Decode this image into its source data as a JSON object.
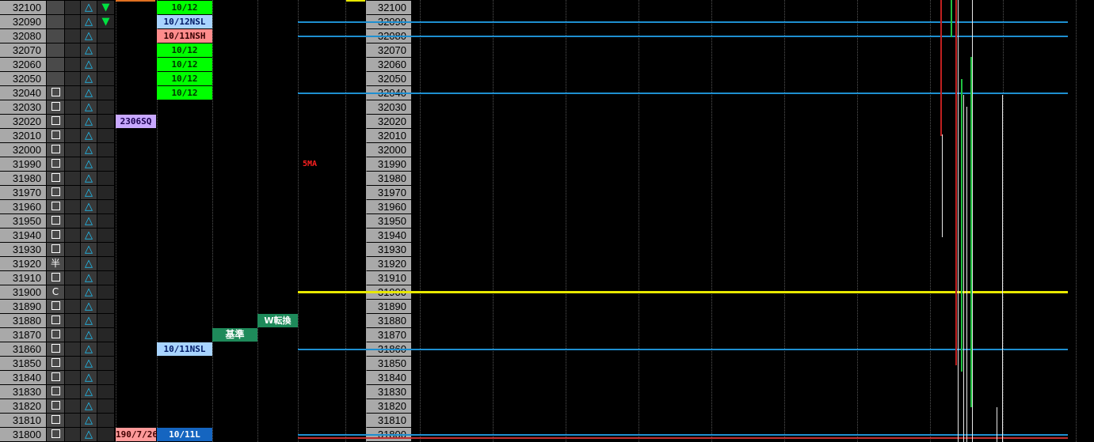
{
  "prices": [
    "32100",
    "32090",
    "32080",
    "32070",
    "32060",
    "32050",
    "32040",
    "32030",
    "32020",
    "32010",
    "32000",
    "31990",
    "31980",
    "31970",
    "31960",
    "31950",
    "31940",
    "31930",
    "31920",
    "31910",
    "31900",
    "31890",
    "31880",
    "31870",
    "31860",
    "31850",
    "31840",
    "31830",
    "31820",
    "31810",
    "31800"
  ],
  "marks": [
    "",
    "",
    "",
    "",
    "",
    "",
    "box",
    "box",
    "box",
    "box",
    "box",
    "box",
    "box",
    "box",
    "box",
    "box",
    "box",
    "box",
    "半",
    "box",
    "C",
    "box",
    "box",
    "box",
    "box",
    "box",
    "box",
    "box",
    "box",
    "box",
    "box"
  ],
  "triangle_glyph": "△",
  "arrow_glyph": "▼",
  "arrow_rows": [
    0,
    1
  ],
  "tags": [
    {
      "row": 0,
      "col": "c2",
      "text": "10/12",
      "style": "t-green"
    },
    {
      "row": 1,
      "col": "c2",
      "text": "10/12NSL",
      "style": "t-blue"
    },
    {
      "row": 2,
      "col": "c2",
      "text": "10/11NSH",
      "style": "t-red"
    },
    {
      "row": 3,
      "col": "c2",
      "text": "10/12",
      "style": "t-green"
    },
    {
      "row": 4,
      "col": "c2",
      "text": "10/12",
      "style": "t-green"
    },
    {
      "row": 5,
      "col": "c2",
      "text": "10/12",
      "style": "t-green"
    },
    {
      "row": 6,
      "col": "c2",
      "text": "10/12",
      "style": "t-green"
    },
    {
      "row": 8,
      "col": "c1",
      "text": "2306SQ",
      "style": "t-purple"
    },
    {
      "row": 24,
      "col": "c2",
      "text": "10/11NSL",
      "style": "t-blue"
    },
    {
      "row": 30,
      "col": "c1",
      "text": "190/7/26",
      "style": "t-pink"
    },
    {
      "row": 30,
      "col": "c2",
      "text": "10/11L",
      "style": "t-dblue"
    },
    {
      "row": 23,
      "col": "c3",
      "text": "基準",
      "style": "t-kijun"
    },
    {
      "row": 22,
      "col": "c4",
      "text": "W転換",
      "style": "t-tenkan"
    }
  ],
  "ma_label": "5MA",
  "colors": {
    "ma_line": "#e8e800",
    "level_line": "#1e8fd0",
    "bottom_line": "#c03030",
    "bar_red": "#c02020",
    "bar_green": "#20c040"
  }
}
